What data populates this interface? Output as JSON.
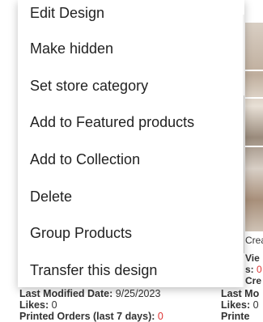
{
  "menu": {
    "items": [
      {
        "label": "Edit Design"
      },
      {
        "label": "Make hidden"
      },
      {
        "label": "Set store category"
      },
      {
        "label": "Add to Featured products"
      },
      {
        "label": "Add to Collection"
      },
      {
        "label": "Delete"
      },
      {
        "label": "Group Products"
      },
      {
        "label": "Transfer this design"
      }
    ]
  },
  "card_left": {
    "last_modified_label": "Last Modified Date:",
    "last_modified_value": "9/25/2023",
    "likes_label": "Likes:",
    "likes_value": "0",
    "printed_label": "Printed Orders (last 7 days):",
    "printed_value": "0"
  },
  "card_right": {
    "crea": "Crea",
    "views_label": "Vie",
    "s_label": "s:",
    "s_value": "0",
    "cre_label": "Cre",
    "last_mod_label": "Last Mo",
    "likes_label": "Likes:",
    "likes_value": "0",
    "printed_label": "Printe"
  },
  "icons": {
    "scroll_up": "chevron-up-icon",
    "scroll_down": "chevron-down-icon"
  }
}
